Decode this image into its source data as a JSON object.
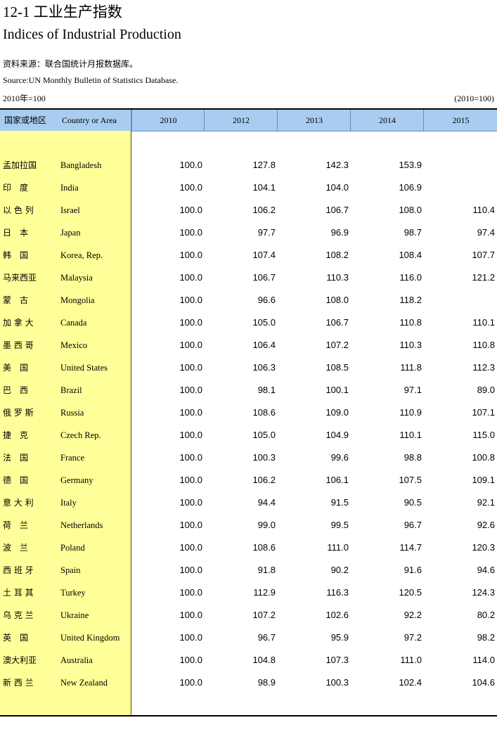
{
  "title_cn": "12-1 工业生产指数",
  "title_en": "Indices of Industrial Production",
  "source_cn": "资料来源：联合国统计月报数据库。",
  "source_en": "Source:UN Monthly Bulletin of Statistics Database.",
  "base_left": "2010年=100",
  "base_right": "(2010=100)",
  "header": {
    "country_cn": "国家或地区",
    "country_en": "Country or Area",
    "years": [
      "2010",
      "2012",
      "2013",
      "2014",
      "2015"
    ]
  },
  "rows": [
    {
      "cn": "孟加拉国",
      "en": "Bangladesh",
      "values": [
        "100.0",
        "127.8",
        "142.3",
        "153.9",
        ""
      ]
    },
    {
      "cn": "印　度",
      "en": "India",
      "values": [
        "100.0",
        "104.1",
        "104.0",
        "106.9",
        ""
      ]
    },
    {
      "cn": "以 色 列",
      "en": "Israel",
      "values": [
        "100.0",
        "106.2",
        "106.7",
        "108.0",
        "110.4"
      ]
    },
    {
      "cn": "日　本",
      "en": "Japan",
      "values": [
        "100.0",
        "97.7",
        "96.9",
        "98.7",
        "97.4"
      ]
    },
    {
      "cn": "韩　国",
      "en": "Korea, Rep.",
      "values": [
        "100.0",
        "107.4",
        "108.2",
        "108.4",
        "107.7"
      ]
    },
    {
      "cn": "马来西亚",
      "en": "Malaysia",
      "values": [
        "100.0",
        "106.7",
        "110.3",
        "116.0",
        "121.2"
      ]
    },
    {
      "cn": "蒙　古",
      "en": "Mongolia",
      "values": [
        "100.0",
        "96.6",
        "108.0",
        "118.2",
        ""
      ]
    },
    {
      "cn": "加 拿 大",
      "en": "Canada",
      "values": [
        "100.0",
        "105.0",
        "106.7",
        "110.8",
        "110.1"
      ]
    },
    {
      "cn": "墨 西 哥",
      "en": "Mexico",
      "values": [
        "100.0",
        "106.4",
        "107.2",
        "110.3",
        "110.8"
      ]
    },
    {
      "cn": "美　国",
      "en": "United States",
      "values": [
        "100.0",
        "106.3",
        "108.5",
        "111.8",
        "112.3"
      ]
    },
    {
      "cn": "巴　西",
      "en": "Brazil",
      "values": [
        "100.0",
        "98.1",
        "100.1",
        "97.1",
        "89.0"
      ]
    },
    {
      "cn": "俄 罗 斯",
      "en": "Russia",
      "values": [
        "100.0",
        "108.6",
        "109.0",
        "110.9",
        "107.1"
      ]
    },
    {
      "cn": "捷　克",
      "en": "Czech Rep.",
      "values": [
        "100.0",
        "105.0",
        "104.9",
        "110.1",
        "115.0"
      ]
    },
    {
      "cn": "法　国",
      "en": "France",
      "values": [
        "100.0",
        "100.3",
        "99.6",
        "98.8",
        "100.8"
      ]
    },
    {
      "cn": "德　国",
      "en": "Germany",
      "values": [
        "100.0",
        "106.2",
        "106.1",
        "107.5",
        "109.1"
      ]
    },
    {
      "cn": "意 大 利",
      "en": "Italy",
      "values": [
        "100.0",
        "94.4",
        "91.5",
        "90.5",
        "92.1"
      ]
    },
    {
      "cn": "荷　兰",
      "en": "Netherlands",
      "values": [
        "100.0",
        "99.0",
        "99.5",
        "96.7",
        "92.6"
      ]
    },
    {
      "cn": "波　兰",
      "en": "Poland",
      "values": [
        "100.0",
        "108.6",
        "111.0",
        "114.7",
        "120.3"
      ]
    },
    {
      "cn": "西 班 牙",
      "en": "Spain",
      "values": [
        "100.0",
        "91.8",
        "90.2",
        "91.6",
        "94.6"
      ]
    },
    {
      "cn": "土 耳 其",
      "en": "Turkey",
      "values": [
        "100.0",
        "112.9",
        "116.3",
        "120.5",
        "124.3"
      ]
    },
    {
      "cn": "乌 克 兰",
      "en": "Ukraine",
      "values": [
        "100.0",
        "107.2",
        "102.6",
        "92.2",
        "80.2"
      ]
    },
    {
      "cn": "英　国",
      "en": "United Kingdom",
      "values": [
        "100.0",
        "96.7",
        "95.9",
        "97.2",
        "98.2"
      ]
    },
    {
      "cn": "澳大利亚",
      "en": "Australia",
      "values": [
        "100.0",
        "104.8",
        "107.3",
        "111.0",
        "114.0"
      ]
    },
    {
      "cn": "新 西 兰",
      "en": "New Zealand",
      "values": [
        "100.0",
        "98.9",
        "100.3",
        "102.4",
        "104.6"
      ]
    }
  ]
}
